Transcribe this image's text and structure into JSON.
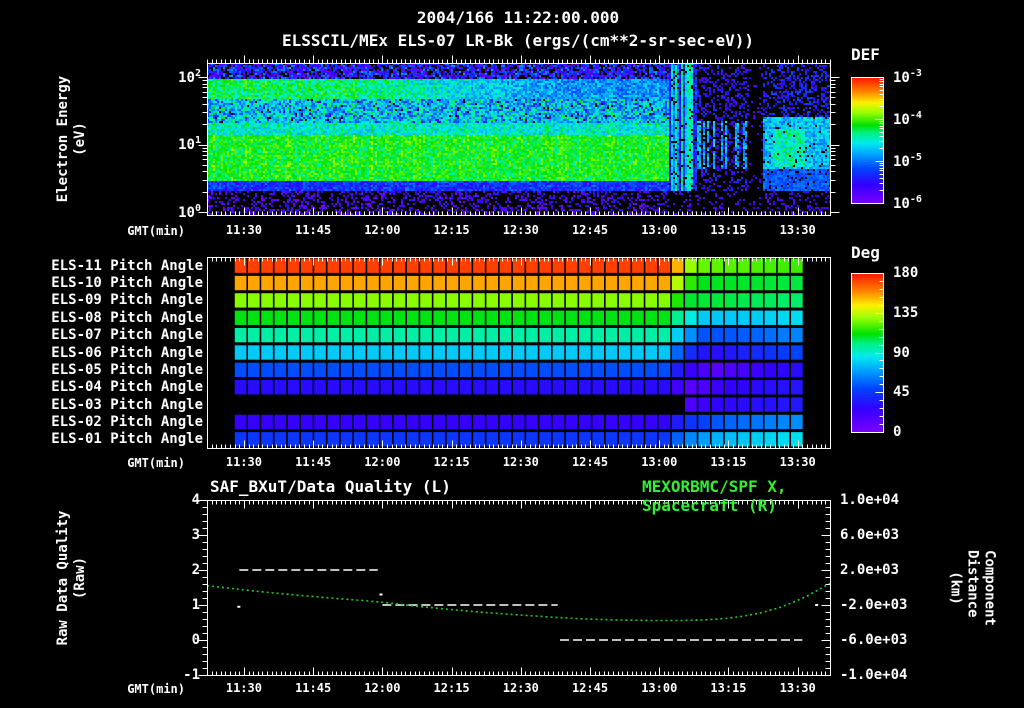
{
  "header": {
    "title_datetime": "2004/166 11:22:00.000",
    "title_instrument": "ELSSCIL/MEx ELS-07 LR-Bk  (ergs/(cm**2-sr-sec-eV))"
  },
  "time_axis": {
    "label": "GMT(min)",
    "start": "11:22",
    "end": "13:37",
    "total_minutes": 135,
    "ticks": [
      {
        "label": "11:30",
        "m": 8
      },
      {
        "label": "11:45",
        "m": 23
      },
      {
        "label": "12:00",
        "m": 38
      },
      {
        "label": "12:15",
        "m": 53
      },
      {
        "label": "12:30",
        "m": 68
      },
      {
        "label": "12:45",
        "m": 83
      },
      {
        "label": "13:00",
        "m": 98
      },
      {
        "label": "13:15",
        "m": 113
      },
      {
        "label": "13:30",
        "m": 128
      }
    ]
  },
  "spectrogram_panel": {
    "y_label": [
      "Electron Energy",
      "(eV)"
    ],
    "y_ticks": [
      {
        "base": "10",
        "exp": "2",
        "frac": 0.092
      },
      {
        "base": "10",
        "exp": "1",
        "frac": 0.536
      },
      {
        "base": "10",
        "exp": "0",
        "frac": 0.98
      }
    ],
    "colorbar": {
      "title": "DEF",
      "labels": [
        {
          "base": "10",
          "exp": "-3",
          "frac": 0.0
        },
        {
          "base": "10",
          "exp": "-4",
          "frac": 0.333
        },
        {
          "base": "10",
          "exp": "-5",
          "frac": 0.667
        },
        {
          "base": "10",
          "exp": "-6",
          "frac": 1.0
        }
      ]
    }
  },
  "pitch_panel": {
    "row_labels": [
      "ELS-11 Pitch Angle",
      "ELS-10 Pitch Angle",
      "ELS-09 Pitch Angle",
      "ELS-08 Pitch Angle",
      "ELS-07 Pitch Angle",
      "ELS-06 Pitch Angle",
      "ELS-05 Pitch Angle",
      "ELS-04 Pitch Angle",
      "ELS-03 Pitch Angle",
      "ELS-02 Pitch Angle",
      "ELS-01 Pitch Angle"
    ],
    "colorbar": {
      "title": "Deg",
      "labels": [
        {
          "text": "180",
          "frac": 0.0
        },
        {
          "text": "135",
          "frac": 0.25
        },
        {
          "text": "90",
          "frac": 0.5
        },
        {
          "text": "45",
          "frac": 0.75
        },
        {
          "text": "0",
          "frac": 1.0
        }
      ]
    }
  },
  "bottom_panel": {
    "title_left": "SAF_BXuT/Data Quality (L)",
    "title_right": "MEXORBMC/SPF X, Spacecraft (R)",
    "left_axis": {
      "label": [
        "Raw Data Quality",
        "(Raw)"
      ],
      "ticks": [
        "4",
        "3",
        "2",
        "1",
        "0",
        "-1"
      ],
      "min": -1,
      "max": 4
    },
    "right_axis": {
      "label": [
        "Component Distance",
        "(km)"
      ],
      "ticks": [
        "1.0e+04",
        "6.0e+03",
        "2.0e+03",
        "-2.0e+03",
        "-6.0e+03",
        "-1.0e+04"
      ],
      "min": -10000,
      "max": 10000
    }
  },
  "chart_data": [
    {
      "type": "heatmap",
      "name": "electron_energy_spectrogram",
      "title": "ELSSCIL/MEx ELS-07 LR-Bk",
      "units": "ergs/(cm**2-sr-sec-eV)",
      "x_range": [
        "11:22",
        "13:37"
      ],
      "ylabel": "Electron Energy (eV)",
      "y_scale": "log",
      "y_range_eV": [
        1,
        160
      ],
      "color_scale": {
        "label": "DEF",
        "scale": "log",
        "min": 1e-06,
        "max": 0.001
      },
      "bands": [
        {
          "e0": 0.0,
          "e1": 0.155,
          "v": 0.1,
          "noise": 0.05,
          "fill": 0.32,
          "desc": "violet specks on black, 1-2 eV"
        },
        {
          "e0": 0.155,
          "e1": 0.23,
          "v": 0.24,
          "noise": 0.05,
          "fill": 1.0,
          "desc": "dim blue band ~2.5 eV"
        },
        {
          "e0": 0.23,
          "e1": 0.52,
          "v": 0.62,
          "noise": 0.04,
          "fill": 1.0,
          "desc": "bright green band 3-15 eV ~1e-4"
        },
        {
          "e0": 0.52,
          "e1": 0.6,
          "v": 0.5,
          "noise": 0.05,
          "fill": 1.0,
          "desc": "green-cyan transition"
        },
        {
          "e0": 0.6,
          "e1": 0.76,
          "v": 0.44,
          "noise": 0.08,
          "fill": 0.97,
          "desc": "cyan with blue noise 20-60 eV"
        },
        {
          "e0": 0.76,
          "e1": 0.895,
          "v": 0.57,
          "noise": 0.05,
          "fill": 1.0,
          "fade": [
            [
              0,
              0.58
            ],
            [
              30,
              0.57
            ],
            [
              55,
              0.46
            ],
            [
              75,
              0.38
            ],
            [
              100,
              0.36
            ]
          ],
          "desc": "upper green band 60-110 eV fading to blue"
        },
        {
          "e0": 0.895,
          "e1": 1.0,
          "v": 0.2,
          "noise": 0.09,
          "fill": 0.72,
          "desc": "dark blue-violet specks >110 eV"
        }
      ],
      "events": [
        {
          "m0": 100,
          "m1": 106,
          "kind": "streaks",
          "desc": "bright cyan vertical streaks at ~13:02-13:08"
        },
        {
          "m0": 106,
          "m1": 117,
          "kind": "sparse",
          "desc": "dropout with scattered specks and cyan mid streaks"
        },
        {
          "m0": 117,
          "m1": 120.5,
          "kind": "gap",
          "desc": "near-black vertical gap ~13:19-13:23"
        },
        {
          "m0": 120.5,
          "m1": 135,
          "kind": "patch",
          "desc": "patchy cyan/green at mid energies to end"
        }
      ]
    },
    {
      "type": "heatmap",
      "name": "pitch_angle_panel",
      "color_scale": {
        "label": "Deg",
        "min": 0,
        "max": 180
      },
      "data_start_m": 5.8,
      "data_end_m": 129.2,
      "cell_minutes": 2.87,
      "rows": [
        {
          "label": "ELS-11 Pitch Angle",
          "segments": [
            [
              0,
              172
            ],
            [
              99,
              172
            ],
            [
              101.5,
              158
            ],
            [
              103.5,
              136
            ],
            [
              106,
              124
            ],
            [
              135,
              117
            ]
          ]
        },
        {
          "label": "ELS-10 Pitch Angle",
          "segments": [
            [
              0,
              155
            ],
            [
              99,
              155
            ],
            [
              102.5,
              130
            ],
            [
              106,
              110
            ],
            [
              135,
              105
            ]
          ]
        },
        {
          "label": "ELS-09 Pitch Angle",
          "segments": [
            [
              0,
              128
            ],
            [
              99,
              128
            ],
            [
              103.5,
              108
            ],
            [
              135,
              101
            ]
          ]
        },
        {
          "label": "ELS-08 Pitch Angle",
          "segments": [
            [
              0,
              110
            ],
            [
              99,
              110
            ],
            [
              103.5,
              92
            ],
            [
              108,
              78
            ],
            [
              120,
              80
            ],
            [
              135,
              86
            ]
          ]
        },
        {
          "label": "ELS-07 Pitch Angle",
          "segments": [
            [
              0,
              96
            ],
            [
              99,
              96
            ],
            [
              103.5,
              72
            ],
            [
              108,
              52
            ],
            [
              118,
              56
            ],
            [
              135,
              70
            ]
          ]
        },
        {
          "label": "ELS-06 Pitch Angle",
          "segments": [
            [
              0,
              79
            ],
            [
              99,
              79
            ],
            [
              103.5,
              46
            ],
            [
              109,
              30
            ],
            [
              120,
              42
            ],
            [
              135,
              56
            ]
          ]
        },
        {
          "label": "ELS-05 Pitch Angle",
          "segments": [
            [
              0,
              52
            ],
            [
              99,
              52
            ],
            [
              103.5,
              28
            ],
            [
              110,
              12
            ],
            [
              121,
              26
            ],
            [
              135,
              36
            ]
          ]
        },
        {
          "label": "ELS-04 Pitch Angle",
          "segments": [
            [
              0,
              31
            ],
            [
              99,
              31
            ],
            [
              105,
              12
            ],
            [
              112,
              26
            ],
            [
              135,
              38
            ]
          ]
        },
        {
          "label": "ELS-03 Pitch Angle",
          "start_m": 103.5,
          "segments": [
            [
              103.5,
              14
            ],
            [
              110,
              28
            ],
            [
              135,
              38
            ]
          ]
        },
        {
          "label": "ELS-02 Pitch Angle",
          "segments": [
            [
              0,
              26
            ],
            [
              99,
              26
            ],
            [
              103.5,
              42
            ],
            [
              112,
              56
            ],
            [
              135,
              70
            ]
          ]
        },
        {
          "label": "ELS-01 Pitch Angle",
          "segments": [
            [
              0,
              45
            ],
            [
              99,
              45
            ],
            [
              103.5,
              62
            ],
            [
              112,
              76
            ],
            [
              135,
              88
            ]
          ]
        }
      ]
    },
    {
      "type": "line",
      "name": "quality_and_distance",
      "series": [
        {
          "name": "SAF_BXuT/Data Quality (L)",
          "axis": "left",
          "color": "#ffffff",
          "style": "dashed-segments",
          "segments": [
            {
              "m0": 7,
              "m1": 37,
              "level": 2
            },
            {
              "m0": 38,
              "m1": 76,
              "level": 1
            },
            {
              "m0": 76.5,
              "m1": 129,
              "level": 0
            }
          ],
          "isolated_points": [
            {
              "m": 6.8,
              "level": 0.95
            },
            {
              "m": 37.6,
              "level": 1.3
            },
            {
              "m": 132,
              "level": 1.0
            }
          ]
        },
        {
          "name": "MEXORBMC/SPF X, Spacecraft (R)",
          "axis": "right",
          "color": "#22cc22",
          "style": "dotted-line",
          "x_minutes": [
            0,
            6,
            12,
            20,
            28,
            34,
            38,
            45,
            52,
            60,
            68,
            75,
            82,
            88,
            95,
            102,
            108,
            112,
            116,
            120,
            124,
            127,
            130,
            132,
            135
          ],
          "km": [
            200,
            -150,
            -500,
            -900,
            -1250,
            -1500,
            -1680,
            -2120,
            -2480,
            -2850,
            -3150,
            -3400,
            -3600,
            -3700,
            -3760,
            -3780,
            -3700,
            -3560,
            -3300,
            -2900,
            -2300,
            -1700,
            -1000,
            -400,
            480
          ]
        }
      ]
    }
  ]
}
